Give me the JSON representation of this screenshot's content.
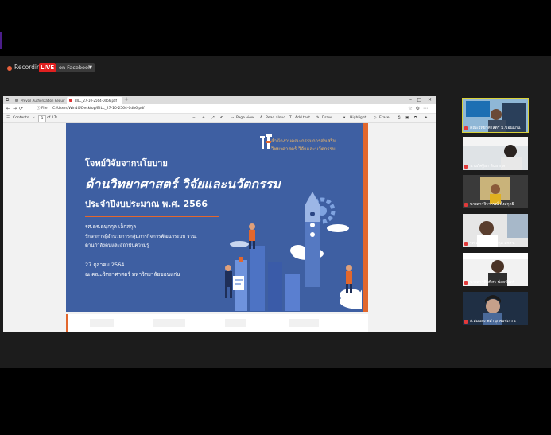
{
  "recording": {
    "recording_label": "Recording",
    "live_badge": "LIVE",
    "destination": "on Facebook"
  },
  "browser": {
    "tabs": [
      {
        "label": "Prevail Authorization Requir"
      },
      {
        "label": "BILL_27-10-2564-0db6.pdf"
      }
    ],
    "new_tab": "+",
    "file_label": "ⓘ File",
    "url": "C:/Users/Win10/Desktop/BILL_27-10-2564-0db6.pdf"
  },
  "pdf_toolbar": {
    "contents": "Contents",
    "page_input": "1",
    "page_total": "of 17",
    "page_view": "Page view",
    "read_aloud": "Read aloud",
    "add_text": "Add text",
    "draw": "Draw",
    "highlight": "Highlight",
    "erase": "Erase"
  },
  "slide": {
    "kicker": "โจทย์วิจัยจากนโยบาย",
    "title": "ด้านวิทยาศาสตร์ วิจัยและนวัตกรรม",
    "subtitle": "ประจำปีงบประมาณ พ.ศ. 2566",
    "speaker": "รศ.ดร.ดนุกกุล เล็กสกุล",
    "role_line1": "รักษาการผู้อำนวยการกลุ่มภารกิจการพัฒนาระบบ ววน.",
    "role_line2": "ด้านกำลังคนและสถาบันความรู้",
    "date": "27 ตุลาคม 2564",
    "venue": "ณ คณะวิทยาศาสตร์ มหาวิทยาลัยขอนแก่น",
    "org_line1": "สำนักงานคณะกรรมการส่งเสริม",
    "org_line2": "วิทยาศาสตร์ วิจัยและนวัตกรรม",
    "colors": {
      "background": "#3e5fa2",
      "accent": "#e2672d",
      "org_text": "#e8b46a"
    }
  },
  "participants": [
    {
      "name": "คณะวิทยาศาสตร์ ม.ขอนแก่น",
      "active": true
    },
    {
      "name": "นางภัคฐิยา พินยากุล",
      "active": false
    },
    {
      "name": "นางสาวจิรากรณ์ ตั้งสกุลธิ",
      "active": false
    },
    {
      "name": "รศ.ดนุกกุล เล็กสกุล สกสว.",
      "active": false
    },
    {
      "name": "นางสาวพิมพิศร น้อยจันทร์",
      "active": false
    },
    {
      "name": "ส.สมบอง พลำนุกพบชเกรน",
      "active": false
    }
  ]
}
